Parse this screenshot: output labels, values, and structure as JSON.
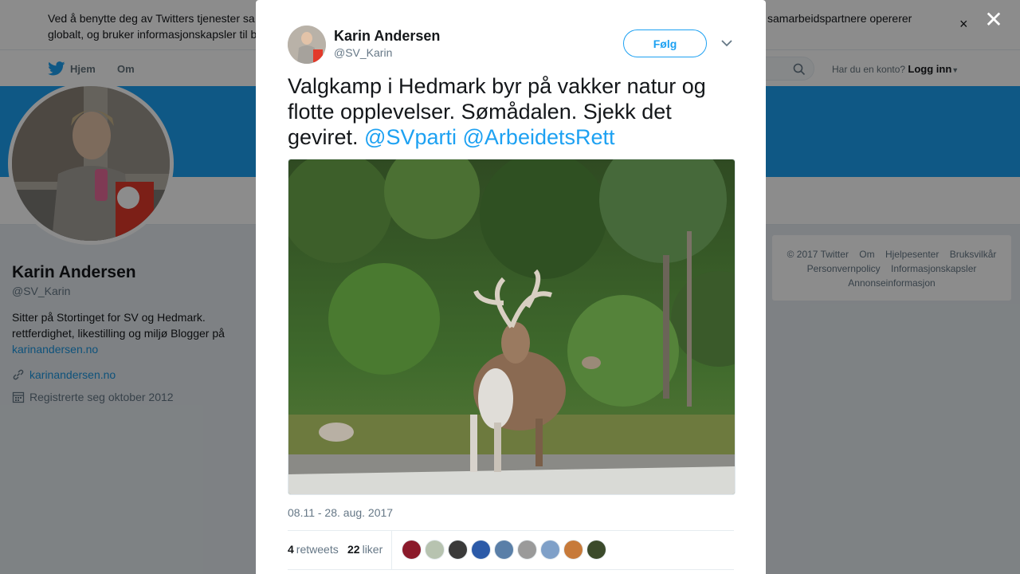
{
  "cookie": {
    "text_left_1": "Ved å benytte deg av Twitters tjenester sa",
    "text_left_2": "globalt, og bruker informasjonskapsler til b",
    "text_right_1": "samarbeidspartnere opererer",
    "text_right_2": "",
    "close_label": "×"
  },
  "nav": {
    "home": "Hjem",
    "about": "Om",
    "account_prompt": "Har du en konto?",
    "login": "Logg inn"
  },
  "profile": {
    "name": "Karin Andersen",
    "handle": "@SV_Karin",
    "bio_1": "Sitter på Stortinget for SV og Hedmark.",
    "bio_2": "rettferdighet, likestilling og miljø Blogger på",
    "bio_link": "karinandersen.no",
    "website": "karinandersen.no",
    "joined": "Registrerte seg oktober 2012"
  },
  "footer": {
    "copyright": "© 2017 Twitter",
    "about": "Om",
    "help": "Hjelpesenter",
    "terms": "Bruksvilkår",
    "privacy": "Personvernpolicy",
    "cookies": "Informasjonskapsler",
    "ads": "Annonseinformasjon"
  },
  "overlay": {
    "close": "✕"
  },
  "tweet": {
    "name": "Karin Andersen",
    "handle": "@SV_Karin",
    "follow": "Følg",
    "text": "Valgkamp i Hedmark byr på vakker natur og flotte opplevelser. Sømådalen. Sjekk det geviret. ",
    "mention_1": "@SVparti",
    "mention_2": "@ArbeidetsRett",
    "timestamp": "08.11 - 28. aug. 2017",
    "retweets_count": "4",
    "retweets_label": "retweets",
    "likes_count": "22",
    "likes_label": "liker",
    "liker_colors": [
      "#8b1a2b",
      "#b7c3b0",
      "#3a3a3a",
      "#2b5aa8",
      "#5a7fa8",
      "#9a9a9a",
      "#7fa0c8",
      "#c77a3a",
      "#3b4a2b"
    ]
  },
  "colors": {
    "accent": "#1da1f2",
    "banner": "#1da1f2",
    "text_secondary": "#657786"
  }
}
